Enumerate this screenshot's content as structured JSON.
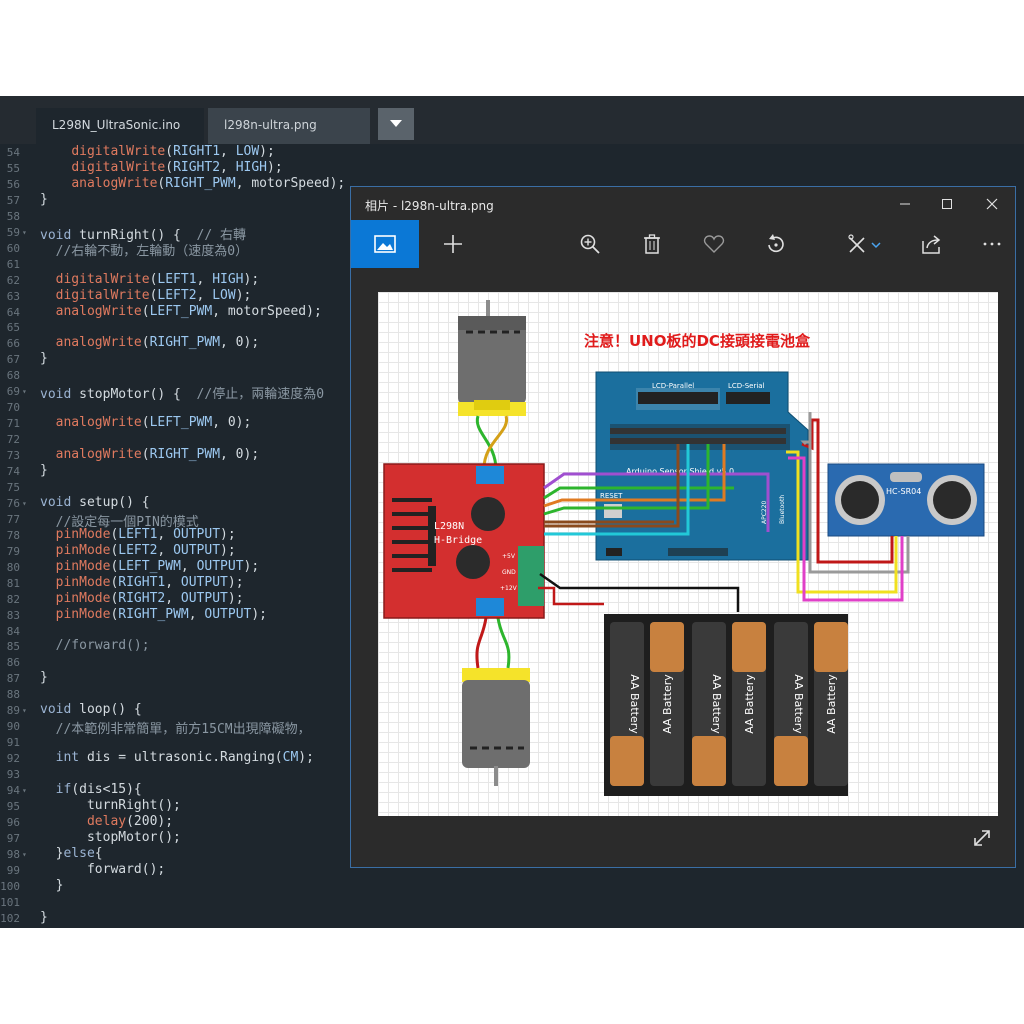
{
  "editor": {
    "tabs": [
      {
        "label": "L298N_UltraSonic.ino"
      },
      {
        "label": "l298n-ultra.png"
      }
    ],
    "line_numbers": [
      "54",
      "55",
      "56",
      "57",
      "58",
      "59",
      "60",
      "61",
      "62",
      "63",
      "64",
      "65",
      "66",
      "67",
      "68",
      "69",
      "70",
      "71",
      "72",
      "73",
      "74",
      "75",
      "76",
      "77",
      "78",
      "79",
      "80",
      "81",
      "82",
      "83",
      "84",
      "85",
      "86",
      "87",
      "88",
      "89",
      "90",
      "91",
      "92",
      "93",
      "94",
      "95",
      "96",
      "97",
      "98",
      "99",
      "100",
      "101",
      "102"
    ],
    "lines": [
      "    digitalWrite(RIGHT1, LOW);",
      "    digitalWrite(RIGHT2, HIGH);",
      "    analogWrite(RIGHT_PWM, motorSpeed);",
      "}",
      "",
      "void turnRight() {  // 右轉",
      "  //右輪不動，左輪動（速度為0）",
      "",
      "  digitalWrite(LEFT1, HIGH);",
      "  digitalWrite(LEFT2, LOW);",
      "  analogWrite(LEFT_PWM, motorSpeed);",
      "",
      "  analogWrite(RIGHT_PWM, 0);",
      "}",
      "",
      "void stopMotor() {  //停止，兩輪速度為0",
      "",
      "  analogWrite(LEFT_PWM, 0);",
      "",
      "  analogWrite(RIGHT_PWM, 0);",
      "}",
      "",
      "void setup() {",
      "  //設定每一個PIN的模式",
      "  pinMode(LEFT1, OUTPUT);",
      "  pinMode(LEFT2, OUTPUT);",
      "  pinMode(LEFT_PWM, OUTPUT);",
      "  pinMode(RIGHT1, OUTPUT);",
      "  pinMode(RIGHT2, OUTPUT);",
      "  pinMode(RIGHT_PWM, OUTPUT);",
      "",
      "  //forward();",
      "",
      "}",
      "",
      "void loop() {",
      "  //本範例非常簡單，前方15CM出現障礙物，",
      "",
      "  int dis = ultrasonic.Ranging(CM);",
      "",
      "  if(dis<15){",
      "      turnRight();",
      "      delay(200);",
      "      stopMotor();",
      "  }else{",
      "      forward();",
      "  }",
      "",
      "}"
    ],
    "fold_lines": [
      "59",
      "69",
      "76",
      "89",
      "94",
      "98"
    ]
  },
  "photos": {
    "title": "相片 - l298n-ultra.png",
    "toolbar_icons": [
      "photo-icon",
      "add-icon",
      "zoom-in-icon",
      "delete-icon",
      "favorite-icon",
      "rotate-icon",
      "edit-icon",
      "share-icon",
      "more-icon"
    ],
    "window_controls": [
      "minimize-icon",
      "maximize-icon",
      "close-icon"
    ]
  },
  "diagram": {
    "note": "注意！UNO板的DC接頭接電池盒",
    "lcd_parallel": "LCD-Parallel",
    "lcd_serial": "LCD-Serial",
    "shield_label": "Arduino Sensor Shield v5.0",
    "reset": "RESET",
    "bluetooth": "Bluetooth",
    "apc220": "APC220",
    "l298n_line1": "L298N",
    "l298n_line2": "H-Bridge",
    "pwr_5v": "+5V",
    "pwr_gnd": "GND",
    "pwr_12v": "+12V",
    "hc_sr04": "HC-SR04",
    "battery_label": "AA Battery",
    "colors": {
      "board_red": "#d32f2f",
      "shield_blue": "#1b6f9e",
      "sensor_blue": "#2a6ab0",
      "wire_purple": "#a04fd0",
      "wire_green": "#2db52d",
      "wire_orange": "#e07b22",
      "wire_brown": "#8a4a1e",
      "wire_cyan": "#22c8d8",
      "wire_yellow": "#f0e020",
      "wire_magenta": "#e040c8",
      "wire_red": "#c01818",
      "wire_gray": "#9a9a9a"
    }
  }
}
